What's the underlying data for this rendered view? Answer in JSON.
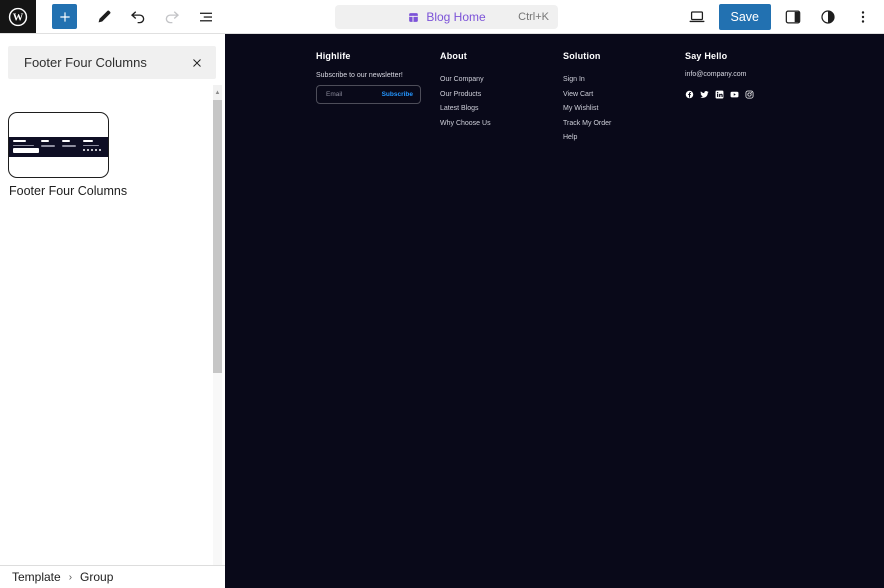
{
  "colors": {
    "accent_blue": "#2271b1",
    "command_purple": "#7c53d8",
    "footer_background": "#090919",
    "subscribe_blue": "#2496ff"
  },
  "topbar": {
    "save_label": "Save",
    "command": {
      "label": "Blog Home",
      "shortcut": "Ctrl+K"
    },
    "icons": [
      "wordpress-logo",
      "inserter-plus",
      "edit-pencil",
      "undo-arrow",
      "redo-arrow",
      "document-overview",
      "template-layout",
      "preview-desktop",
      "settings-sidebar",
      "styles-contrast",
      "options-kebab"
    ]
  },
  "sidebar": {
    "search_value": "Footer Four Columns",
    "pattern_label": "Footer Four Columns",
    "breadcrumb": {
      "items": [
        "Template",
        "Group"
      ],
      "separator": "›"
    }
  },
  "canvas": {
    "footer": {
      "columns": [
        {
          "title": "Highlife",
          "text": "Subscribe to our newsletter!",
          "email_placeholder": "Email",
          "button": "Subscribe"
        },
        {
          "title": "About",
          "links": [
            "Our Company",
            "Our Products",
            "Latest Blogs",
            "Why Choose Us"
          ]
        },
        {
          "title": "Solution",
          "links": [
            "Sign In",
            "View Cart",
            "My Wishlist",
            "Track My Order",
            "Help"
          ]
        },
        {
          "title": "Say Hello",
          "email": "info@company.com",
          "social": [
            "facebook",
            "twitter",
            "linkedin",
            "youtube",
            "instagram"
          ]
        }
      ]
    }
  }
}
